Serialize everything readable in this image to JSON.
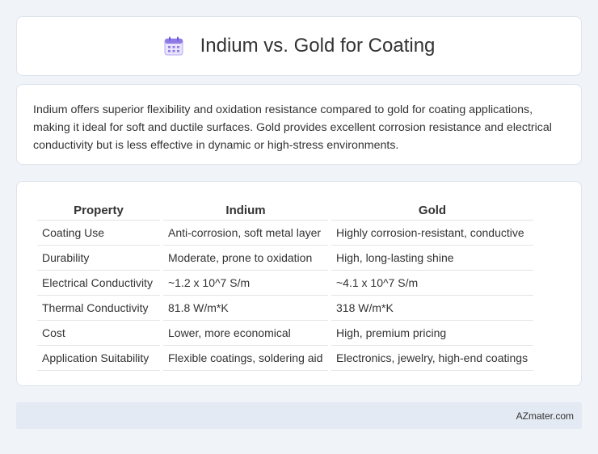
{
  "header": {
    "title": "Indium vs. Gold for Coating",
    "icon": "calendar-icon"
  },
  "description": "Indium offers superior flexibility and oxidation resistance compared to gold for coating applications, making it ideal for soft and ductile surfaces. Gold provides excellent corrosion resistance and electrical conductivity but is less effective in dynamic or high-stress environments.",
  "table": {
    "headers": [
      "Property",
      "Indium",
      "Gold"
    ],
    "rows": [
      [
        "Coating Use",
        "Anti-corrosion, soft metal layer",
        "Highly corrosion-resistant, conductive"
      ],
      [
        "Durability",
        "Moderate, prone to oxidation",
        "High, long-lasting shine"
      ],
      [
        "Electrical Conductivity",
        "~1.2 x 10^7 S/m",
        "~4.1 x 10^7 S/m"
      ],
      [
        "Thermal Conductivity",
        "81.8 W/m*K",
        "318 W/m*K"
      ],
      [
        "Cost",
        "Lower, more economical",
        "High, premium pricing"
      ],
      [
        "Application Suitability",
        "Flexible coatings, soldering aid",
        "Electronics, jewelry, high-end coatings"
      ]
    ]
  },
  "footer": {
    "brand": "AZmater.com"
  }
}
